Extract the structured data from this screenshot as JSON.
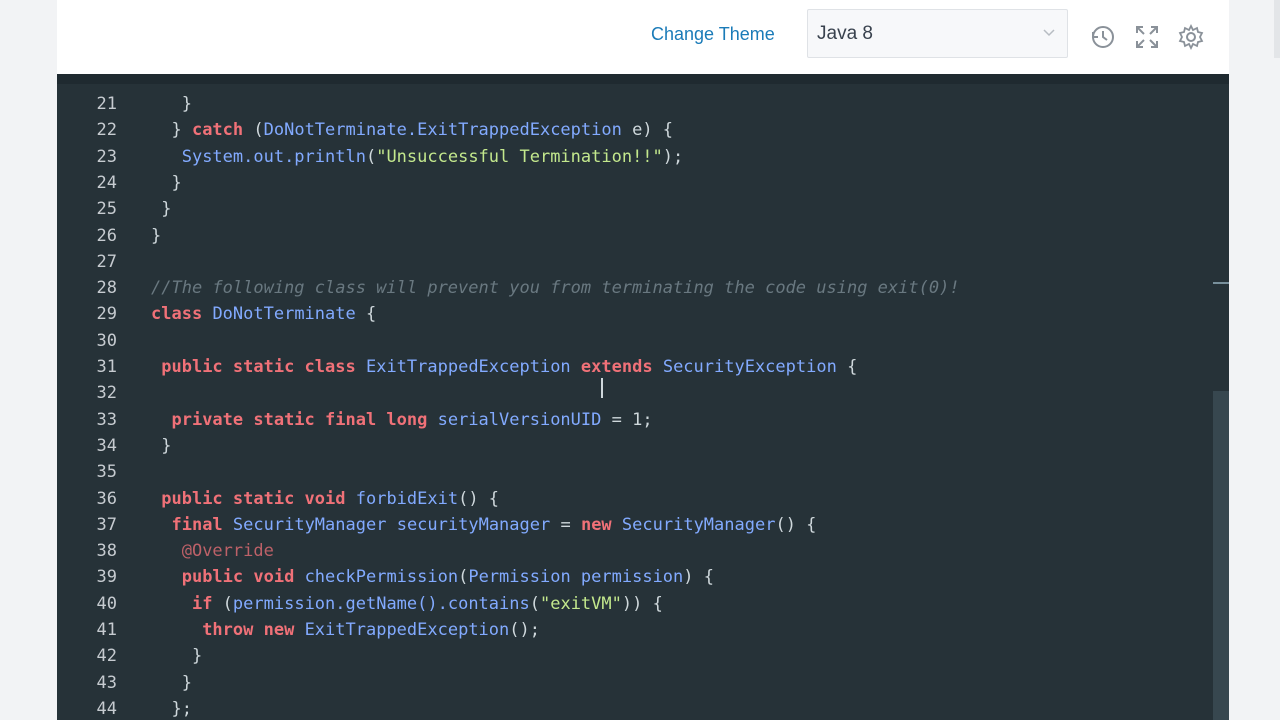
{
  "toolbar": {
    "change_theme_label": "Change Theme",
    "language_selected": "Java 8",
    "icons": [
      "reset-history-icon",
      "fullscreen-icon",
      "settings-icon"
    ]
  },
  "colors": {
    "editor_bg": "#263238",
    "keyword": "#f07178",
    "type": "#82aaff",
    "string": "#c3e88d",
    "comment": "#697880",
    "link": "#1a7bb8"
  },
  "code": {
    "line_numbers": [
      "21",
      "22",
      "23",
      "24",
      "25",
      "26",
      "27",
      "28",
      "29",
      "30",
      "31",
      "32",
      "33",
      "34",
      "35",
      "36",
      "37",
      "38",
      "39",
      "40",
      "41",
      "42",
      "43",
      "44"
    ],
    "lines": [
      [
        {
          "t": "pu",
          "v": "   }"
        }
      ],
      [
        {
          "t": "pu",
          "v": "  } "
        },
        {
          "t": "kw",
          "v": "catch"
        },
        {
          "t": "pu",
          "v": " ("
        },
        {
          "t": "ty",
          "v": "DoNotTerminate.ExitTrappedException"
        },
        {
          "t": "pu",
          "v": " e) {"
        }
      ],
      [
        {
          "t": "pu",
          "v": "   "
        },
        {
          "t": "ty",
          "v": "System.out.println"
        },
        {
          "t": "pu",
          "v": "("
        },
        {
          "t": "st",
          "v": "\"Unsuccessful Termination!!\""
        },
        {
          "t": "pu",
          "v": ");"
        }
      ],
      [
        {
          "t": "pu",
          "v": "  }"
        }
      ],
      [
        {
          "t": "pu",
          "v": " }"
        }
      ],
      [
        {
          "t": "pu",
          "v": "}"
        }
      ],
      [],
      [
        {
          "t": "cm",
          "v": "//The following class will prevent you from terminating the code using exit(0)!"
        }
      ],
      [
        {
          "t": "kw",
          "v": "class"
        },
        {
          "t": "pu",
          "v": " "
        },
        {
          "t": "ty",
          "v": "DoNotTerminate"
        },
        {
          "t": "pu",
          "v": " {"
        }
      ],
      [],
      [
        {
          "t": "pu",
          "v": " "
        },
        {
          "t": "kw",
          "v": "public static class"
        },
        {
          "t": "pu",
          "v": " "
        },
        {
          "t": "ty",
          "v": "ExitTrappedException"
        },
        {
          "t": "pu",
          "v": " "
        },
        {
          "t": "kw",
          "v": "extends"
        },
        {
          "t": "pu",
          "v": " "
        },
        {
          "t": "ty",
          "v": "SecurityException"
        },
        {
          "t": "pu",
          "v": " {"
        }
      ],
      [],
      [
        {
          "t": "pu",
          "v": "  "
        },
        {
          "t": "kw",
          "v": "private static final long"
        },
        {
          "t": "pu",
          "v": " "
        },
        {
          "t": "ty",
          "v": "serialVersionUID"
        },
        {
          "t": "pu",
          "v": " = 1;"
        }
      ],
      [
        {
          "t": "pu",
          "v": " }"
        }
      ],
      [],
      [
        {
          "t": "pu",
          "v": " "
        },
        {
          "t": "kw",
          "v": "public static void"
        },
        {
          "t": "pu",
          "v": " "
        },
        {
          "t": "ty",
          "v": "forbidExit"
        },
        {
          "t": "pu",
          "v": "() {"
        }
      ],
      [
        {
          "t": "pu",
          "v": "  "
        },
        {
          "t": "kw",
          "v": "final"
        },
        {
          "t": "pu",
          "v": " "
        },
        {
          "t": "ty",
          "v": "SecurityManager"
        },
        {
          "t": "pu",
          "v": " "
        },
        {
          "t": "ty",
          "v": "securityManager"
        },
        {
          "t": "pu",
          "v": " = "
        },
        {
          "t": "kw",
          "v": "new"
        },
        {
          "t": "pu",
          "v": " "
        },
        {
          "t": "ty",
          "v": "SecurityManager"
        },
        {
          "t": "pu",
          "v": "() {"
        }
      ],
      [
        {
          "t": "pu",
          "v": "   "
        },
        {
          "t": "an",
          "v": "@Override"
        }
      ],
      [
        {
          "t": "pu",
          "v": "   "
        },
        {
          "t": "kw",
          "v": "public void"
        },
        {
          "t": "pu",
          "v": " "
        },
        {
          "t": "ty",
          "v": "checkPermission"
        },
        {
          "t": "pu",
          "v": "("
        },
        {
          "t": "ty",
          "v": "Permission permission"
        },
        {
          "t": "pu",
          "v": ") {"
        }
      ],
      [
        {
          "t": "pu",
          "v": "    "
        },
        {
          "t": "kw",
          "v": "if"
        },
        {
          "t": "pu",
          "v": " ("
        },
        {
          "t": "ty",
          "v": "permission.getName().contains"
        },
        {
          "t": "pu",
          "v": "("
        },
        {
          "t": "st",
          "v": "\"exitVM\""
        },
        {
          "t": "pu",
          "v": ")) {"
        }
      ],
      [
        {
          "t": "pu",
          "v": "     "
        },
        {
          "t": "kw",
          "v": "throw new"
        },
        {
          "t": "pu",
          "v": " "
        },
        {
          "t": "ty",
          "v": "ExitTrappedException"
        },
        {
          "t": "pu",
          "v": "();"
        }
      ],
      [
        {
          "t": "pu",
          "v": "    }"
        }
      ],
      [
        {
          "t": "pu",
          "v": "   }"
        }
      ],
      [
        {
          "t": "pu",
          "v": "  };"
        }
      ]
    ]
  }
}
